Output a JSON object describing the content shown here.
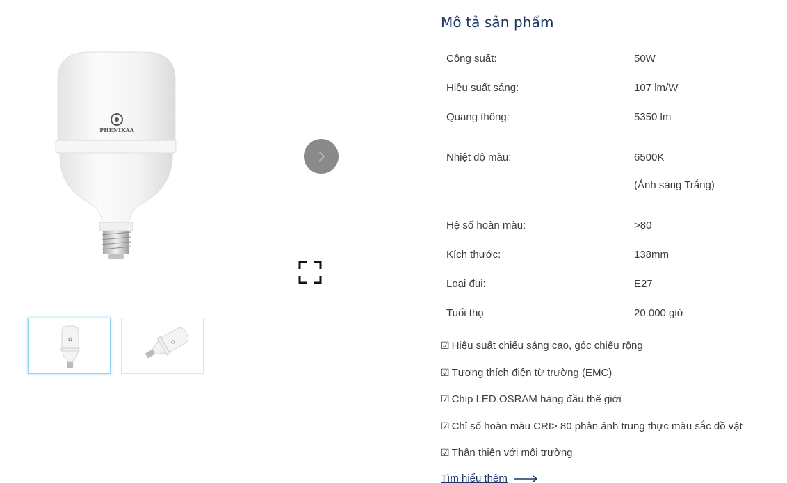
{
  "gallery": {
    "brand_text": "PHENIKAA",
    "next_icon": "chevron-right-icon",
    "fullscreen_icon": "fullscreen-icon"
  },
  "description": {
    "title": "Mô tả sản phẩm",
    "specs": [
      {
        "label": "Công suất:",
        "value": "50W"
      },
      {
        "label": "Hiệu suất sáng:",
        "value": "107 lm/W"
      },
      {
        "label": "Quang thông:",
        "value": "5350 lm"
      },
      {
        "label": "Nhiệt độ màu:",
        "value": "6500K",
        "subvalue": "(Ánh sáng Trắng)"
      },
      {
        "label": "Hệ số hoàn màu:",
        "value": ">80"
      },
      {
        "label": "Kích thước:",
        "value": "138mm"
      },
      {
        "label": "Loại đui:",
        "value": "E27"
      },
      {
        "label": "Tuổi thọ",
        "value": "20.000 giờ"
      }
    ],
    "features": [
      {
        "check": "☑",
        "text": "Hiệu suất chiếu sáng cao, góc chiếu rộng"
      },
      {
        "check": "☑",
        "text": "Tương thích điện từ trường (EMC)"
      },
      {
        "check": "☑",
        "text": "Chip LED OSRAM hàng đầu thế giới"
      },
      {
        "check": "☑",
        "text": "Chỉ số hoàn màu CRI> 80 phản ánh trung thực màu sắc đồ vật"
      },
      {
        "check": "☑",
        "text": "Thân thiện với môi trường"
      }
    ],
    "learn_more": "Tìm hiểu thêm"
  },
  "colors": {
    "title": "#1f3766",
    "text": "#3d3d3d",
    "nav_button": "#8a8a8a",
    "active_thumb_border": "#8fd3f0"
  }
}
